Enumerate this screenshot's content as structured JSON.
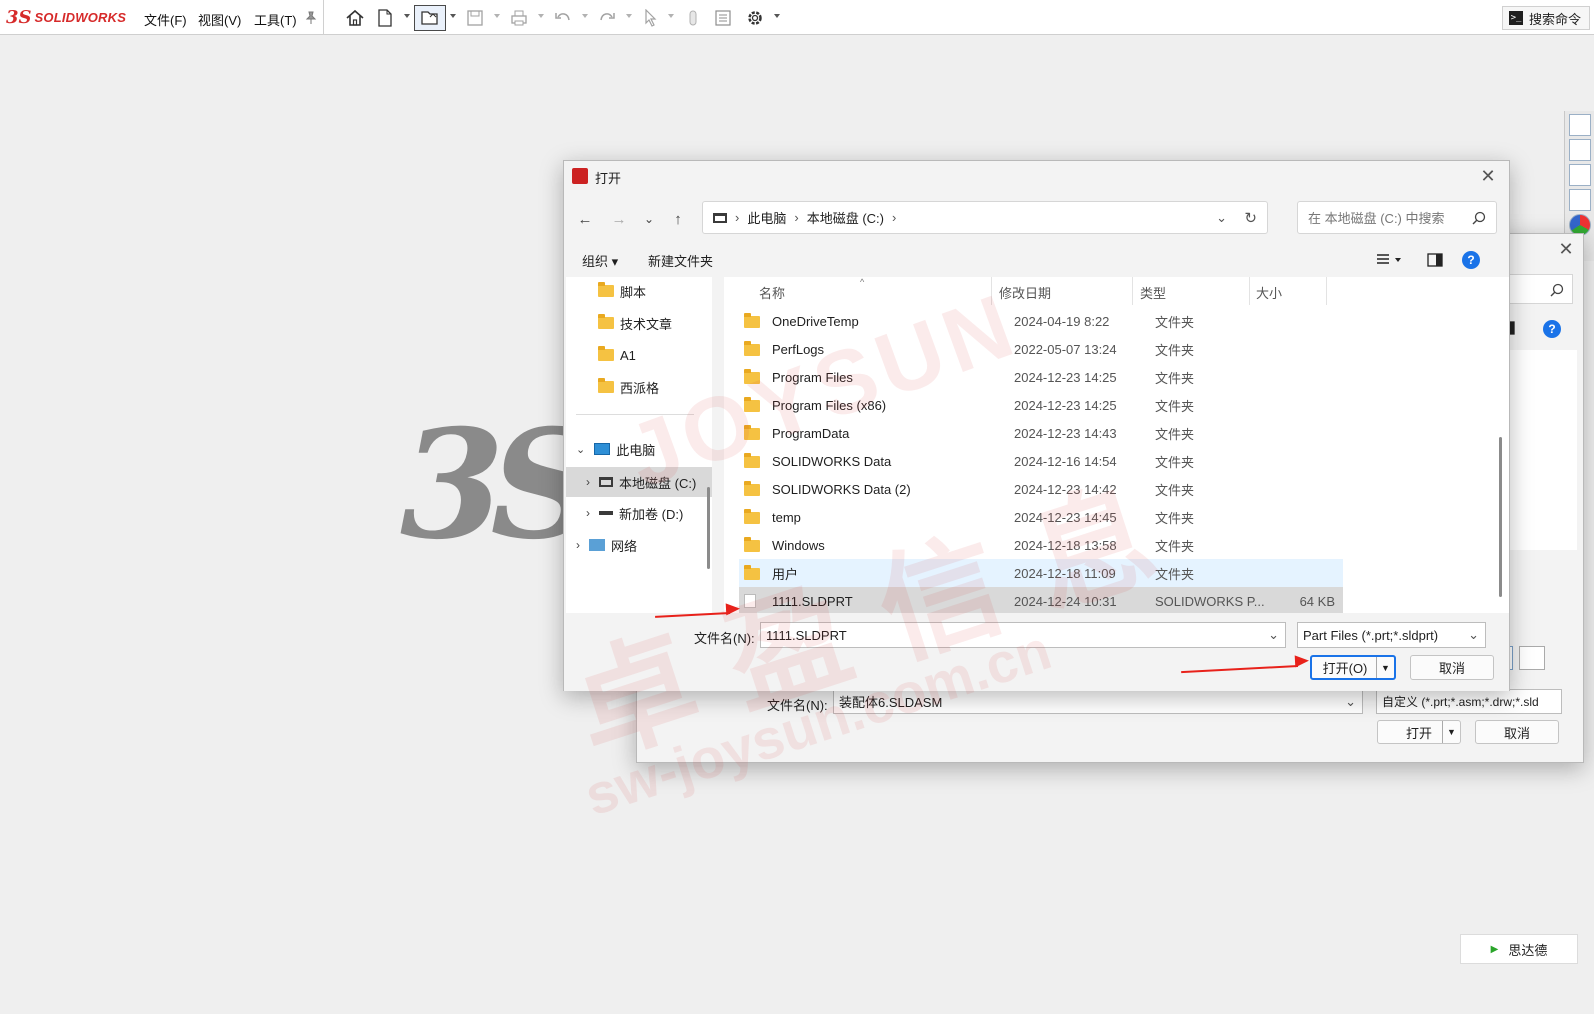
{
  "app": {
    "name": "SOLIDWORKS",
    "ds_mark": "3S",
    "splash_mark": "3S"
  },
  "menu": {
    "file": "文件(F)",
    "view": "视图(V)",
    "tools": "工具(T)"
  },
  "search_command": {
    "label": "搜索命令",
    "prompt": ">_"
  },
  "watermark": {
    "name": "JOYSUN",
    "cn": "卓盈信息",
    "url": "sw-joysun.com.cn"
  },
  "back_dialog": {
    "filename_label": "文件名(N):",
    "filename_value": "装配体6.SLDASM",
    "filter_value": "自定义 (*.prt;*.asm;*.drw;*.sld",
    "open_label": "打开",
    "cancel_label": "取消"
  },
  "dialog": {
    "title": "打开",
    "address": {
      "segments": [
        "此电脑",
        "本地磁盘 (C:)"
      ]
    },
    "search_placeholder": "在 本地磁盘 (C:) 中搜索",
    "organize_label": "组织 ▾",
    "new_folder_label": "新建文件夹",
    "sidebar": {
      "quick": [
        {
          "label": "脚本"
        },
        {
          "label": "技术文章"
        },
        {
          "label": "A1"
        },
        {
          "label": "西派格"
        }
      ],
      "this_pc": "此电脑",
      "drives": [
        {
          "label": "本地磁盘 (C:)",
          "selected": true
        },
        {
          "label": "新加卷 (D:)"
        }
      ],
      "network": "网络"
    },
    "columns": {
      "name": "名称",
      "date": "修改日期",
      "type": "类型",
      "size": "大小"
    },
    "files": [
      {
        "name": "OneDriveTemp",
        "date": "2024-04-19 8:22",
        "type": "文件夹",
        "size": ""
      },
      {
        "name": "PerfLogs",
        "date": "2022-05-07 13:24",
        "type": "文件夹",
        "size": ""
      },
      {
        "name": "Program Files",
        "date": "2024-12-23 14:25",
        "type": "文件夹",
        "size": ""
      },
      {
        "name": "Program Files (x86)",
        "date": "2024-12-23 14:25",
        "type": "文件夹",
        "size": ""
      },
      {
        "name": "ProgramData",
        "date": "2024-12-23 14:43",
        "type": "文件夹",
        "size": ""
      },
      {
        "name": "SOLIDWORKS Data",
        "date": "2024-12-16 14:54",
        "type": "文件夹",
        "size": ""
      },
      {
        "name": "SOLIDWORKS Data (2)",
        "date": "2024-12-23 14:42",
        "type": "文件夹",
        "size": ""
      },
      {
        "name": "temp",
        "date": "2024-12-23 14:45",
        "type": "文件夹",
        "size": ""
      },
      {
        "name": "Windows",
        "date": "2024-12-18 13:58",
        "type": "文件夹",
        "size": ""
      },
      {
        "name": "用户",
        "date": "2024-12-18 11:09",
        "type": "文件夹",
        "size": "",
        "hover": true
      },
      {
        "name": "1111.SLDPRT",
        "date": "2024-12-24 10:31",
        "type": "SOLIDWORKS P...",
        "size": "64 KB",
        "selected": true
      }
    ],
    "filename_label": "文件名(N):",
    "filename_value": "1111.SLDPRT",
    "filter_value": "Part Files (*.prt;*.sldprt)",
    "open_label": "打开(O)",
    "cancel_label": "取消"
  },
  "sde_button": {
    "label": "思达德"
  }
}
